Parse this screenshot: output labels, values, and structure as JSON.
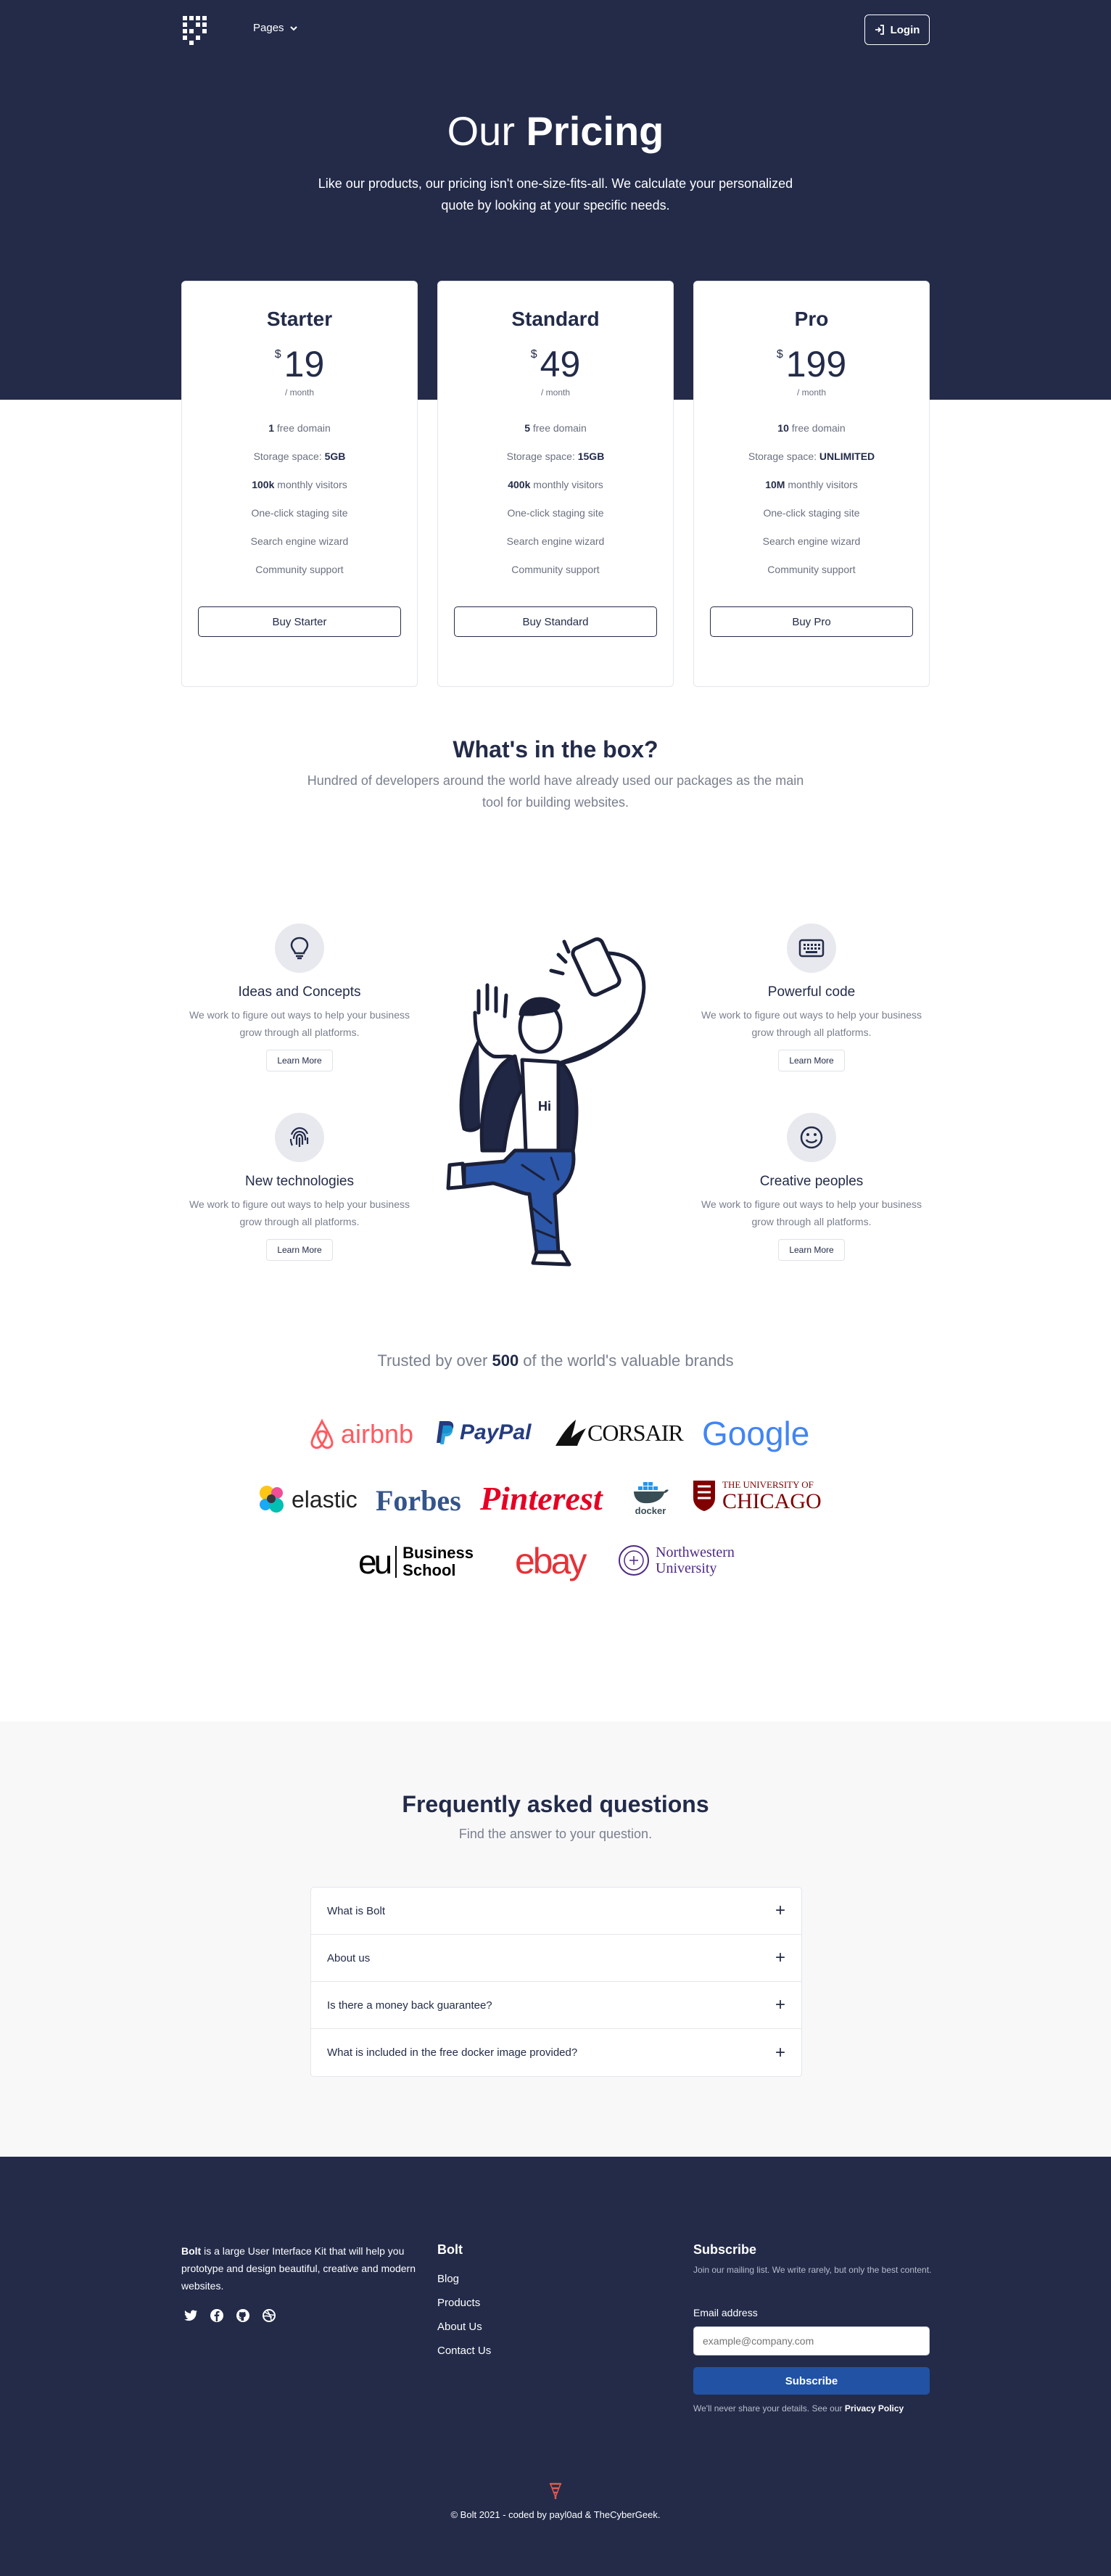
{
  "nav": {
    "pages_label": "Pages",
    "login_label": "Login"
  },
  "hero": {
    "title_light": "Our ",
    "title_bold": "Pricing",
    "subtitle": "Like our products, our pricing isn't one-size-fits-all. We calculate your personalized quote by looking at your specific needs."
  },
  "plans": [
    {
      "name": "Starter",
      "currency": "$",
      "price": "19",
      "period": "/ month",
      "features": [
        {
          "bold": "1",
          "text": " free domain"
        },
        {
          "pre": "Storage space: ",
          "bold": "5GB"
        },
        {
          "bold": "100k",
          "text": " monthly visitors"
        },
        {
          "text": "One-click staging site"
        },
        {
          "text": "Search engine wizard"
        },
        {
          "text": "Community support"
        }
      ],
      "button": "Buy Starter"
    },
    {
      "name": "Standard",
      "currency": "$",
      "price": "49",
      "period": "/ month",
      "features": [
        {
          "bold": "5",
          "text": " free domain"
        },
        {
          "pre": "Storage space: ",
          "bold": "15GB"
        },
        {
          "bold": "400k",
          "text": " monthly visitors"
        },
        {
          "text": "One-click staging site"
        },
        {
          "text": "Search engine wizard"
        },
        {
          "text": "Community support"
        }
      ],
      "button": "Buy Standard"
    },
    {
      "name": "Pro",
      "currency": "$",
      "price": "199",
      "period": "/ month",
      "features": [
        {
          "bold": "10",
          "text": " free domain"
        },
        {
          "pre": "Storage space: ",
          "bold": "UNLIMITED"
        },
        {
          "bold": "10M",
          "text": " monthly visitors"
        },
        {
          "text": "One-click staging site"
        },
        {
          "text": "Search engine wizard"
        },
        {
          "text": "Community support"
        }
      ],
      "button": "Buy Pro"
    }
  ],
  "box": {
    "title": "What's in the box?",
    "subtitle": "Hundred of developers around the world have already used our packages as the main tool for building websites.",
    "features": [
      {
        "title": "Ideas and Concepts",
        "text": "We work to figure out ways to help your business grow through all platforms.",
        "button": "Learn More",
        "icon": "lightbulb-icon"
      },
      {
        "title": "Powerful code",
        "text": "We work to figure out ways to help your business grow through all platforms.",
        "button": "Learn More",
        "icon": "keyboard-icon"
      },
      {
        "title": "New technologies",
        "text": "We work to figure out ways to help your business grow through all platforms.",
        "button": "Learn More",
        "icon": "fingerprint-icon"
      },
      {
        "title": "Creative peoples",
        "text": "We work to figure out ways to help your business grow through all platforms.",
        "button": "Learn More",
        "icon": "smiley-icon"
      }
    ],
    "illustration_text": "Hi"
  },
  "trusted": {
    "pre": "Trusted by over ",
    "count": "500",
    "post": " of the world's valuable brands"
  },
  "brands": {
    "airbnb": "airbnb",
    "paypal": "PayPal",
    "corsair": "CORSAIR",
    "google": "Google",
    "elastic": "elastic",
    "forbes": "Forbes",
    "pinterest": "Pinterest",
    "docker": "docker",
    "chicago_1": "THE UNIVERSITY OF",
    "chicago_2": "CHICAGO",
    "eu_mark": "eu",
    "eu_1": "Business",
    "eu_2": "School",
    "ebay": "ebay",
    "northwestern_1": "Northwestern",
    "northwestern_2": "University"
  },
  "faq": {
    "title": "Frequently asked questions",
    "subtitle": "Find the answer to your question.",
    "items": [
      "What is Bolt",
      "About us",
      "Is there a money back guarantee?",
      "What is included in the free docker image provided?"
    ]
  },
  "footer": {
    "brand": "Bolt",
    "about": " is a large User Interface Kit that will help you prototype and design beautiful, creative and modern websites.",
    "links_title": "Bolt",
    "links": [
      "Blog",
      "Products",
      "About Us",
      "Contact Us"
    ],
    "subscribe_title": "Subscribe",
    "subscribe_text": "Join our mailing list. We write rarely, but only the best content.",
    "email_label": "Email address",
    "email_placeholder": "example@company.com",
    "subscribe_button": "Subscribe",
    "note_pre": "We'll never share your details. See our ",
    "note_link": "Privacy Policy",
    "copyright": "© Bolt 2021 - coded by payl0ad & TheCyberGeek."
  },
  "colors": {
    "navy": "#232b49",
    "accent": "#2152a3",
    "muted": "#7a7f8e"
  }
}
